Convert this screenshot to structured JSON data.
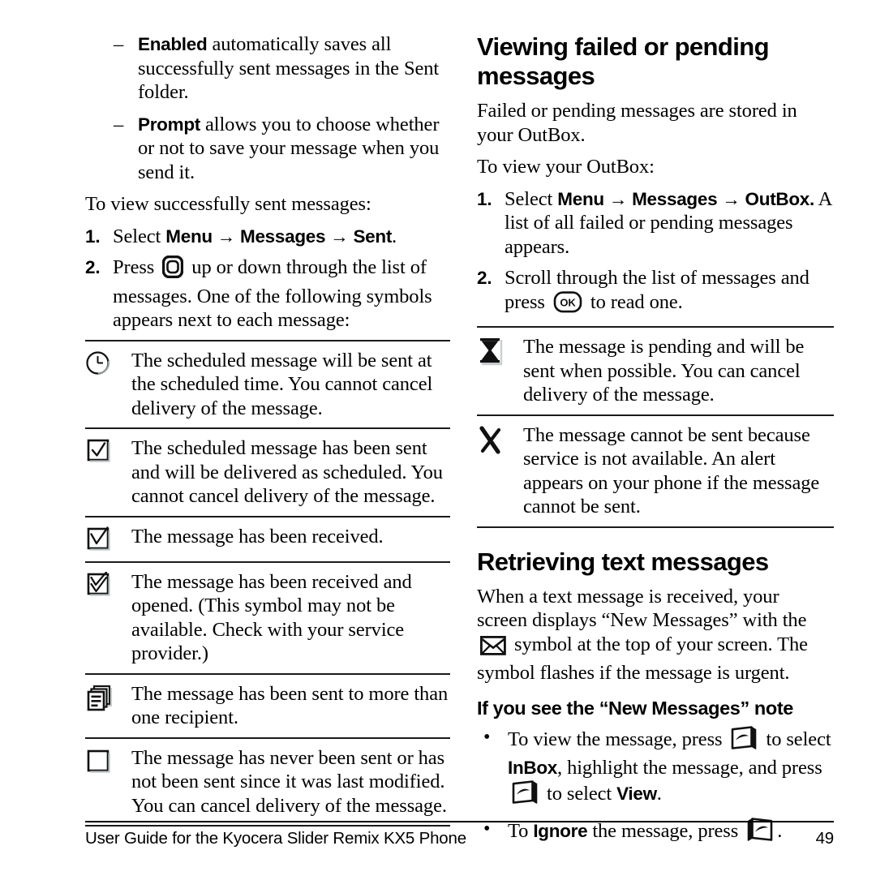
{
  "page": {
    "number": "49",
    "footer_text": "User Guide for the Kyocera Slider Remix KX5 Phone"
  },
  "left_column": {
    "sub_bullets": [
      {
        "dash": "–",
        "term": "Enabled",
        "text": " automatically saves all successfully sent messages in the Sent folder."
      },
      {
        "dash": "–",
        "term": "Prompt",
        "text": " allows you to choose whether or not to save your message when you send it."
      }
    ],
    "intro": "To view successfully sent messages:",
    "steps": [
      {
        "number": "1.",
        "pre": "Select ",
        "menu1": "Menu",
        "arrow1": "→",
        "menu2": "Messages",
        "arrow2": "→",
        "menu3": "Sent",
        "post": "."
      },
      {
        "number": "2.",
        "pre": "Press ",
        "icon": "navigation-key-icon",
        "post": " up or down through the list of messages. One of the following symbols appears next to each message:"
      }
    ],
    "symbol_table": [
      {
        "icon": "clock-icon",
        "text": "The scheduled message will be sent at the scheduled time. You cannot cancel delivery of the message."
      },
      {
        "icon": "checkbox-checked-icon",
        "text": "The scheduled message has been sent and will be delivered as scheduled. You cannot cancel delivery of the message."
      },
      {
        "icon": "checkbox-received-icon",
        "text": "The message has been received."
      },
      {
        "icon": "checkbox-received-opened-icon",
        "text": "The message has been received and opened. (This symbol may not be available. Check with your service provider.)"
      },
      {
        "icon": "multiple-documents-icon",
        "text": "The message has been sent to more than one recipient."
      },
      {
        "icon": "empty-box-icon",
        "text": "The message has never been sent or has not been sent since it was last modified. You can cancel delivery of the message."
      }
    ]
  },
  "right_column": {
    "heading": "Viewing failed or pending messages",
    "paragraph1": "Failed or pending messages are stored in your OutBox.",
    "paragraph2": "To view your OutBox:",
    "steps": [
      {
        "number": "1.",
        "pre": "Select ",
        "menu1": "Menu",
        "arrow1": "→",
        "menu2": "Messages",
        "arrow2": "→",
        "menu3": "OutBox.",
        "post": " A list of all failed or pending messages appears."
      },
      {
        "number": "2.",
        "pre": "Scroll through the list of messages and press ",
        "icon": "ok-key-icon",
        "post": " to read one."
      }
    ],
    "symbol_table": [
      {
        "icon": "hourglass-icon",
        "text": "The message is pending and will be sent when possible. You can cancel delivery of the message."
      },
      {
        "icon": "x-mark-icon",
        "text": "The message cannot be sent because service is not available. An alert appears on your phone if the message cannot be sent."
      }
    ],
    "heading2": "Retrieving text messages",
    "paragraph3_part1": "When a text message is received, your screen displays “New Messages” with the ",
    "envelope_icon": "envelope-icon",
    "paragraph3_part2": " symbol at the top of your screen. The symbol flashes if the message is urgent.",
    "subheading": "If you see the “New Messages” note",
    "bullets": [
      {
        "marker": "•",
        "part1": "To view the message, press ",
        "icon1": "right-softkey-icon",
        "part2": " to select ",
        "bold1": "InBox",
        "part3": ", highlight the message, and press ",
        "icon2": "right-softkey-icon",
        "part4": " to select ",
        "bold2": "View",
        "part5": "."
      },
      {
        "marker": "•",
        "part1": "To ",
        "bold1": "Ignore",
        "part2": " the message, press ",
        "icon1": "left-softkey-icon",
        "part3": "."
      }
    ]
  },
  "colors": {
    "text": "#000000",
    "rule": "#1a1a1a",
    "icon_shadow": "#b9c3c6"
  }
}
